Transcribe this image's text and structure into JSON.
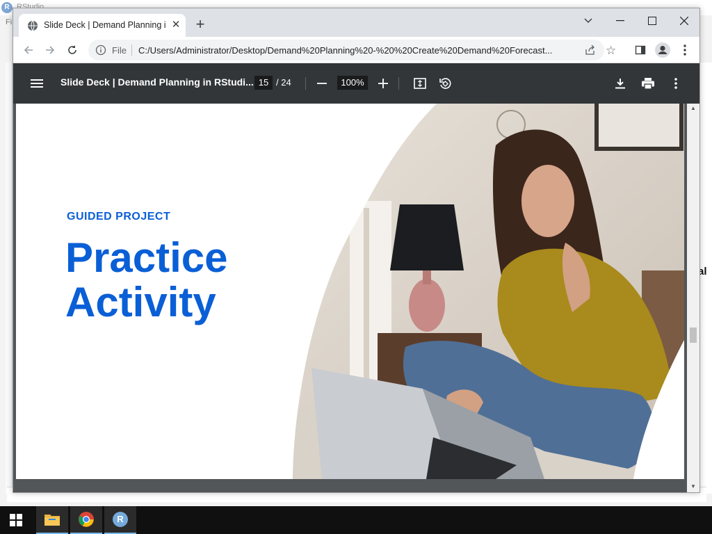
{
  "background": {
    "app_title": "RStudio",
    "menu_fragment": "Fi",
    "right_text": "al"
  },
  "browser": {
    "tab": {
      "title": "Slide Deck | Demand Planning in"
    },
    "omnibox": {
      "scheme_label": "File",
      "url": "C:/Users/Administrator/Desktop/Demand%20Planning%20-%20%20Create%20Demand%20Forecast..."
    }
  },
  "pdf": {
    "title": "Slide Deck | Demand Planning in RStudi...",
    "page_current": "15",
    "page_total": "/ 24",
    "zoom": "100%"
  },
  "slide": {
    "eyebrow": "GUIDED PROJECT",
    "headline_line1": "Practice",
    "headline_line2": "Activity"
  },
  "colors": {
    "accent_blue": "#0a5fd6",
    "pdf_toolbar": "#323639",
    "tabstrip": "#dee1e6"
  },
  "taskbar": {
    "items": [
      "start-icon",
      "file-explorer-icon",
      "chrome-icon",
      "rstudio-icon"
    ],
    "rstudio_letter": "R"
  }
}
